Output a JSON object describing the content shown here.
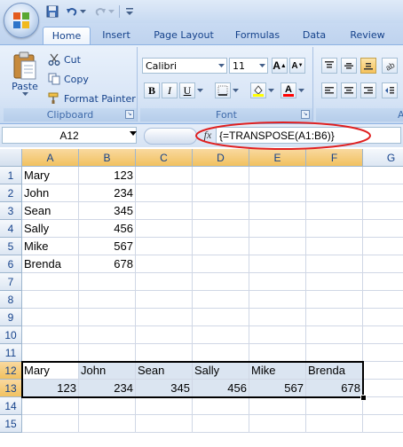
{
  "quick_access": {
    "items": [
      "save-icon",
      "undo-icon",
      "redo-icon",
      "customize-icon"
    ]
  },
  "tabs": [
    "Home",
    "Insert",
    "Page Layout",
    "Formulas",
    "Data",
    "Review"
  ],
  "active_tab": "Home",
  "ribbon": {
    "clipboard": {
      "paste": "Paste",
      "cut": "Cut",
      "copy": "Copy",
      "format_painter": "Format Painter",
      "label": "Clipboard"
    },
    "font": {
      "font_name": "Calibri",
      "font_size": "11",
      "label": "Font"
    }
  },
  "formula_bar": {
    "name_box": "A12",
    "fx": "fx",
    "formula": "{=TRANSPOSE(A1:B6)}"
  },
  "sheet": {
    "columns": [
      "A",
      "B",
      "C",
      "D",
      "E",
      "F",
      "G"
    ],
    "rows": [
      "1",
      "2",
      "3",
      "4",
      "5",
      "6",
      "7",
      "8",
      "9",
      "10",
      "11",
      "12",
      "13",
      "14",
      "15"
    ],
    "names": [
      "Mary",
      "John",
      "Sean",
      "Sally",
      "Mike",
      "Brenda"
    ],
    "values": [
      "123",
      "234",
      "345",
      "456",
      "567",
      "678"
    ],
    "active_cell": "A12",
    "selection": "A12:F13"
  },
  "colors": {
    "selection_highlight": "#dbe5f1",
    "header_selected": "#f1c15f",
    "annotation": "#e02020"
  }
}
